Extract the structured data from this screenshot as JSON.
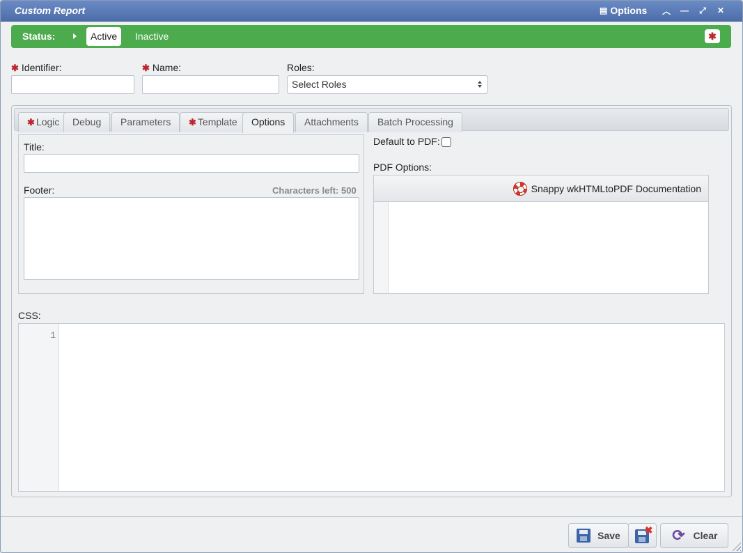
{
  "window": {
    "title": "Custom Report",
    "options_label": "Options"
  },
  "status": {
    "label": "Status:",
    "active": "Active",
    "inactive": "Inactive",
    "selected": "Active",
    "required_marker": "✱"
  },
  "fields": {
    "identifier_label": "Identifier:",
    "identifier_value": "",
    "name_label": "Name:",
    "name_value": "",
    "roles_label": "Roles:",
    "roles_placeholder": "Select Roles"
  },
  "tabs": [
    {
      "label": "Logic",
      "required": true
    },
    {
      "label": "Debug",
      "required": false
    },
    {
      "label": "Parameters",
      "required": false
    },
    {
      "label": "Template",
      "required": true
    },
    {
      "label": "Options",
      "required": false,
      "active": true
    },
    {
      "label": "Attachments",
      "required": false
    },
    {
      "label": "Batch Processing",
      "required": false
    }
  ],
  "options": {
    "title_label": "Title:",
    "title_value": "",
    "footer_label": "Footer:",
    "footer_value": "",
    "chars_left": "Characters left: 500",
    "default_pdf_label": "Default to PDF:",
    "default_pdf_checked": false,
    "pdf_options_label": "PDF Options:",
    "doc_link": "Snappy wkHTMLtoPDF Documentation",
    "css_label": "CSS:",
    "css_line_number": "1"
  },
  "buttons": {
    "save": "Save",
    "clear": "Clear"
  },
  "colors": {
    "title_bar": "#5579b7",
    "status_bar": "#4cab4c",
    "required": "#c0242b"
  }
}
